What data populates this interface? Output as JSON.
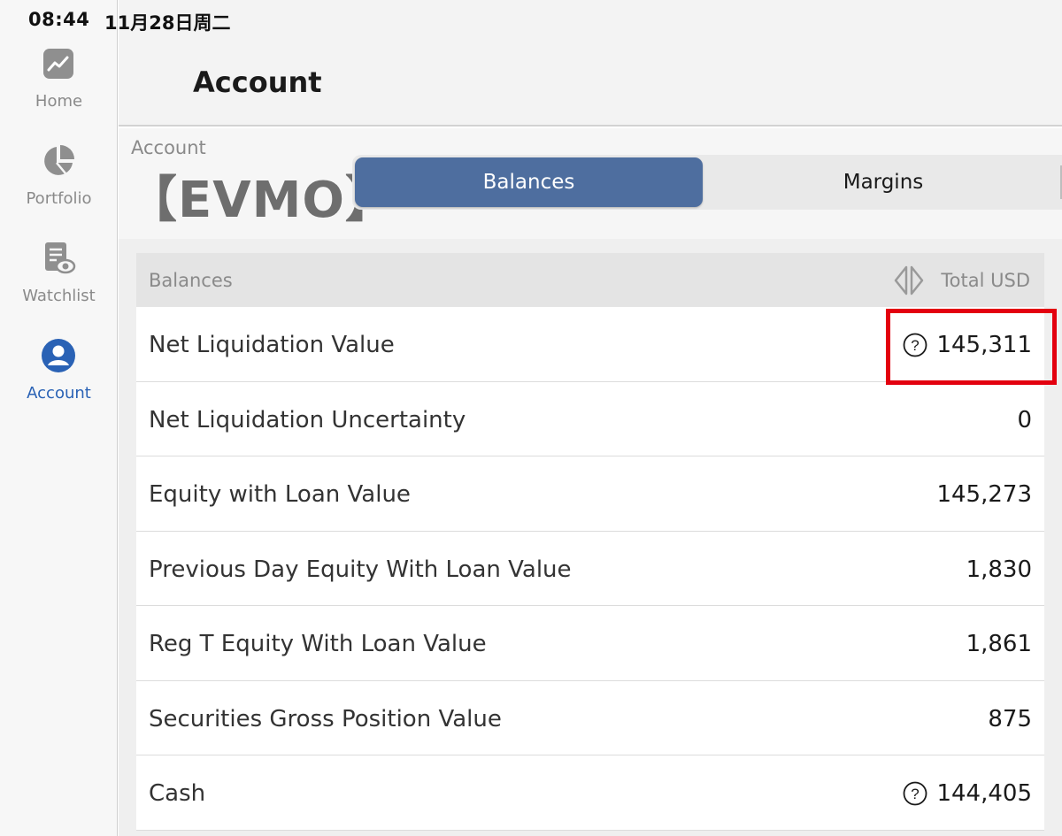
{
  "status_bar": {
    "time": "08:44",
    "date": "11月28日周二"
  },
  "sidebar": {
    "items": [
      {
        "label": "Home",
        "icon": "chart-line-icon",
        "active": false
      },
      {
        "label": "Portfolio",
        "icon": "pie-chart-icon",
        "active": false
      },
      {
        "label": "Watchlist",
        "icon": "watchlist-eye-icon",
        "active": false
      },
      {
        "label": "Account",
        "icon": "user-circle-icon",
        "active": true
      }
    ]
  },
  "header": {
    "title": "Account"
  },
  "account": {
    "caption": "Account",
    "id": "【EVMO】"
  },
  "tabs": [
    {
      "label": "Balances",
      "selected": true
    },
    {
      "label": "Margins",
      "selected": false
    }
  ],
  "table": {
    "header_left": "Balances",
    "header_right": "Total USD",
    "rows": [
      {
        "label": "Net Liquidation Value",
        "value": "145,311",
        "help_icon": true
      },
      {
        "label": "Net Liquidation Uncertainty",
        "value": "0",
        "help_icon": false
      },
      {
        "label": "Equity with Loan Value",
        "value": "145,273",
        "help_icon": false
      },
      {
        "label": "Previous Day Equity With Loan Value",
        "value": "1,830",
        "help_icon": false
      },
      {
        "label": "Reg T Equity With Loan Value",
        "value": "1,861",
        "help_icon": false
      },
      {
        "label": "Securities Gross Position Value",
        "value": "875",
        "help_icon": false
      },
      {
        "label": "Cash",
        "value": "144,405",
        "help_icon": true
      }
    ]
  },
  "colors": {
    "accent": "#4e6e9f",
    "active_nav": "#2a62b5",
    "highlight": "#e3000f"
  }
}
